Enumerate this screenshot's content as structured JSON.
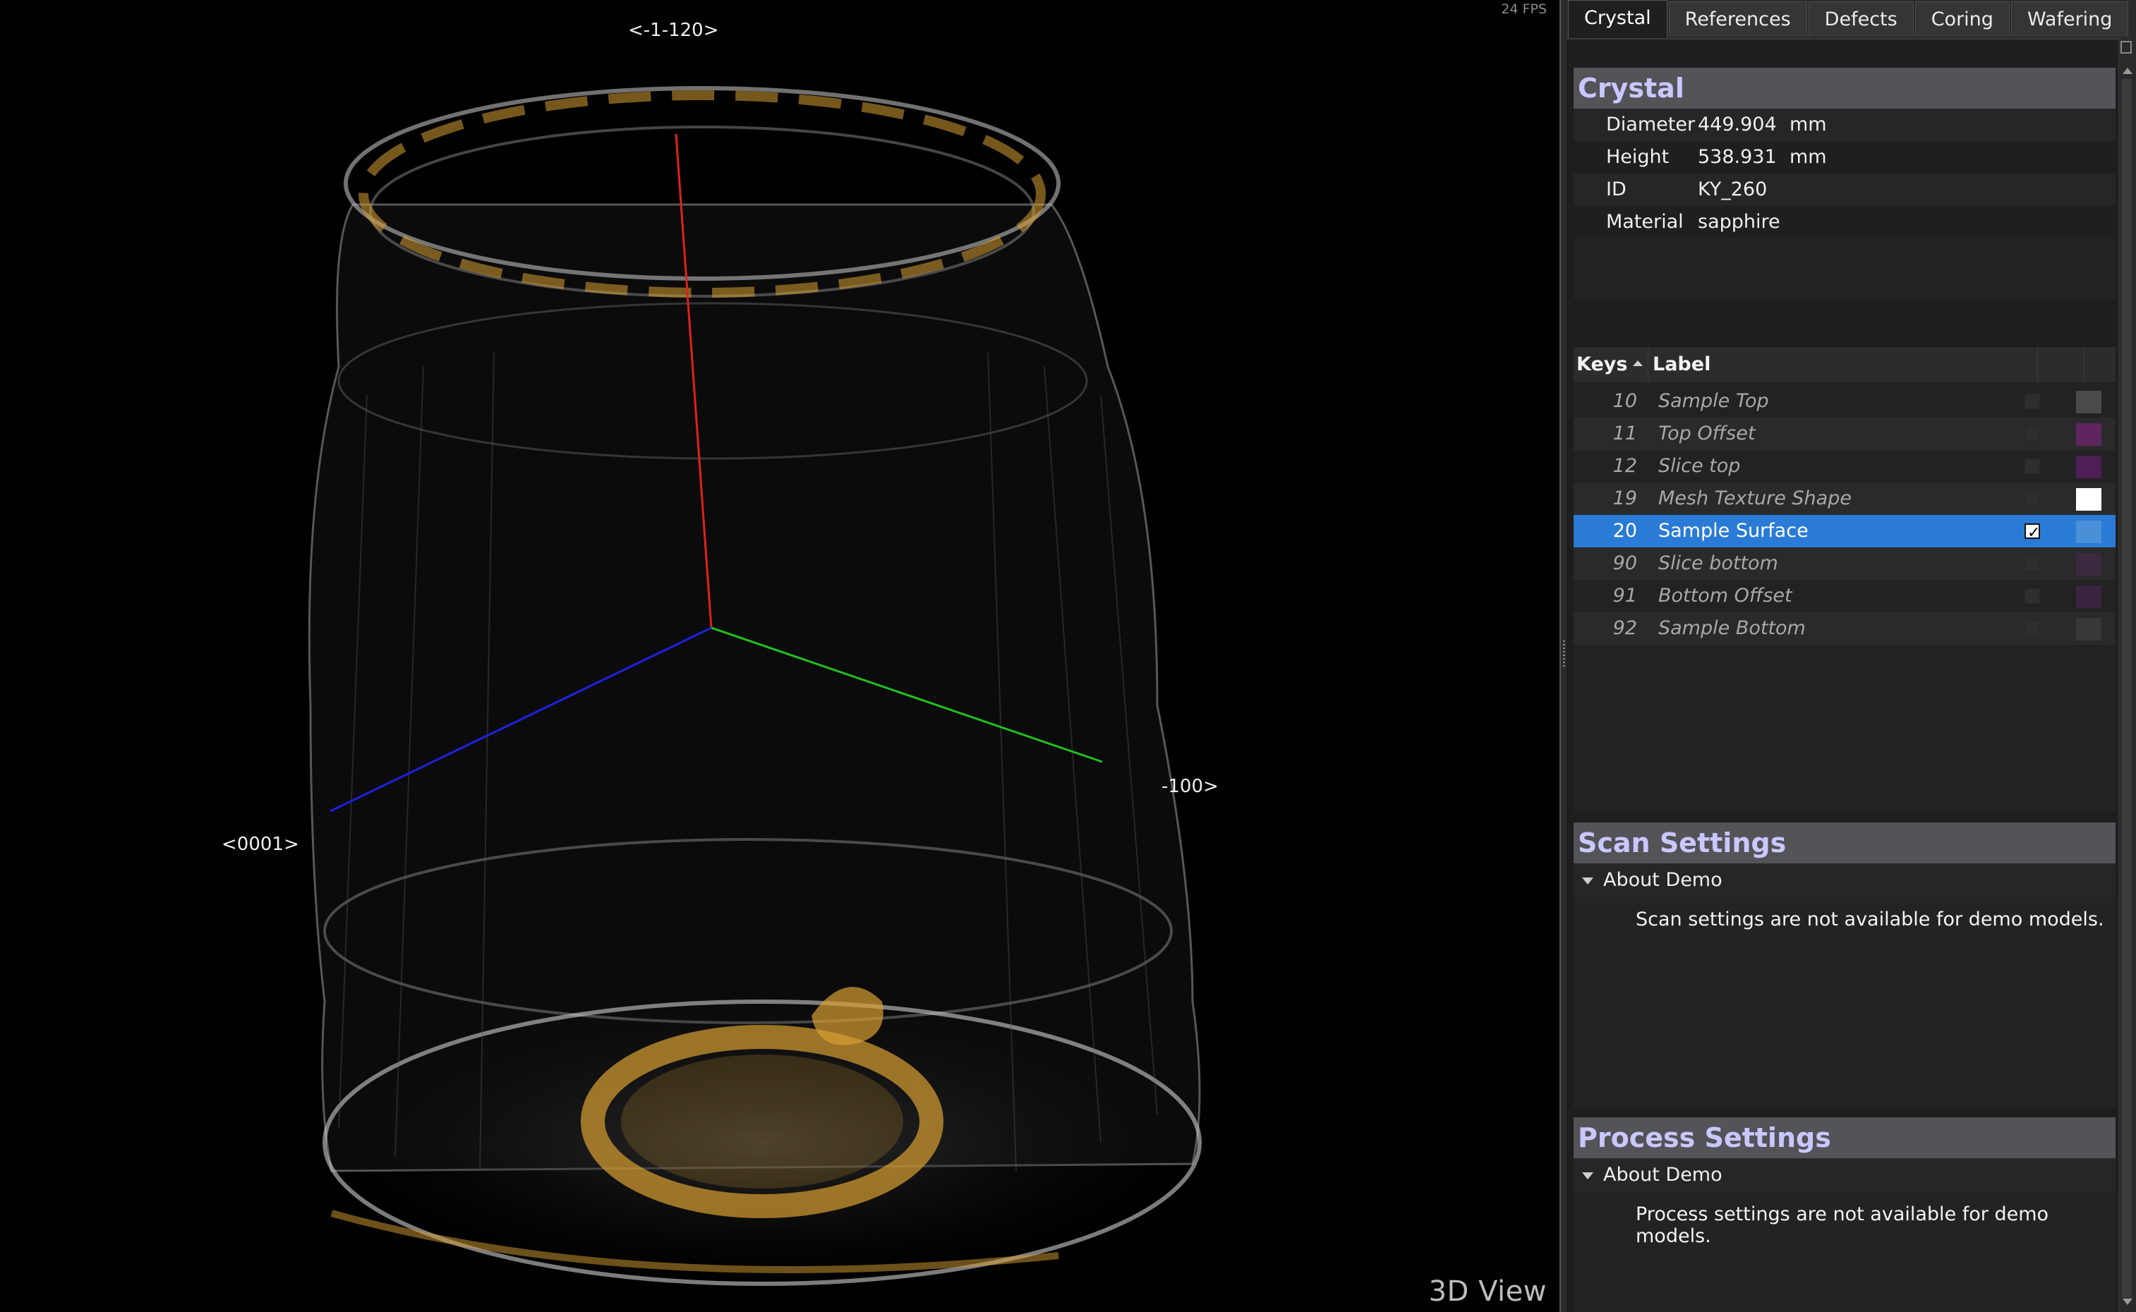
{
  "viewport": {
    "fps": "24 FPS",
    "title": "3D View",
    "axis_labels": {
      "top": "<-1-120>",
      "left": "<0001>",
      "right": "-100>"
    },
    "colors": {
      "axis_x": "#e02020",
      "axis_y": "#20c020",
      "axis_z": "#2020e0",
      "points": "#d8d8d8",
      "defects": "#d9a033"
    }
  },
  "tabs": [
    {
      "label": "Crystal",
      "active": true
    },
    {
      "label": "References",
      "active": false
    },
    {
      "label": "Defects",
      "active": false
    },
    {
      "label": "Coring",
      "active": false
    },
    {
      "label": "Wafering",
      "active": false
    }
  ],
  "crystal": {
    "header": "Crystal",
    "properties": [
      {
        "name": "Diameter",
        "value": "449.904",
        "unit": "mm"
      },
      {
        "name": "Height",
        "value": "538.931",
        "unit": "mm"
      },
      {
        "name": "ID",
        "value": "KY_260",
        "unit": ""
      },
      {
        "name": "Material",
        "value": "sapphire",
        "unit": ""
      }
    ]
  },
  "keys_table": {
    "col_keys": "Keys",
    "col_label": "Label",
    "rows": [
      {
        "key": "10",
        "label": "Sample Top",
        "checked": false,
        "selected": false,
        "color": "#4a4a4a"
      },
      {
        "key": "11",
        "label": "Top Offset",
        "checked": false,
        "selected": false,
        "color": "#5e2560"
      },
      {
        "key": "12",
        "label": "Slice top",
        "checked": false,
        "selected": false,
        "color": "#4e1f57"
      },
      {
        "key": "19",
        "label": "Mesh Texture Shape",
        "checked": false,
        "selected": false,
        "color": "#ffffff"
      },
      {
        "key": "20",
        "label": "Sample Surface",
        "checked": true,
        "selected": true,
        "color": "#4a90d9"
      },
      {
        "key": "90",
        "label": "Slice bottom",
        "checked": false,
        "selected": false,
        "color": "#3b2a40"
      },
      {
        "key": "91",
        "label": "Bottom Offset",
        "checked": false,
        "selected": false,
        "color": "#3a2440"
      },
      {
        "key": "92",
        "label": "Sample Bottom",
        "checked": false,
        "selected": false,
        "color": "#383838"
      }
    ]
  },
  "scan_settings": {
    "header": "Scan Settings",
    "group": "About Demo",
    "message": "Scan settings are not available for demo models."
  },
  "process_settings": {
    "header": "Process Settings",
    "group": "About Demo",
    "message": "Process settings are not available for demo models."
  }
}
